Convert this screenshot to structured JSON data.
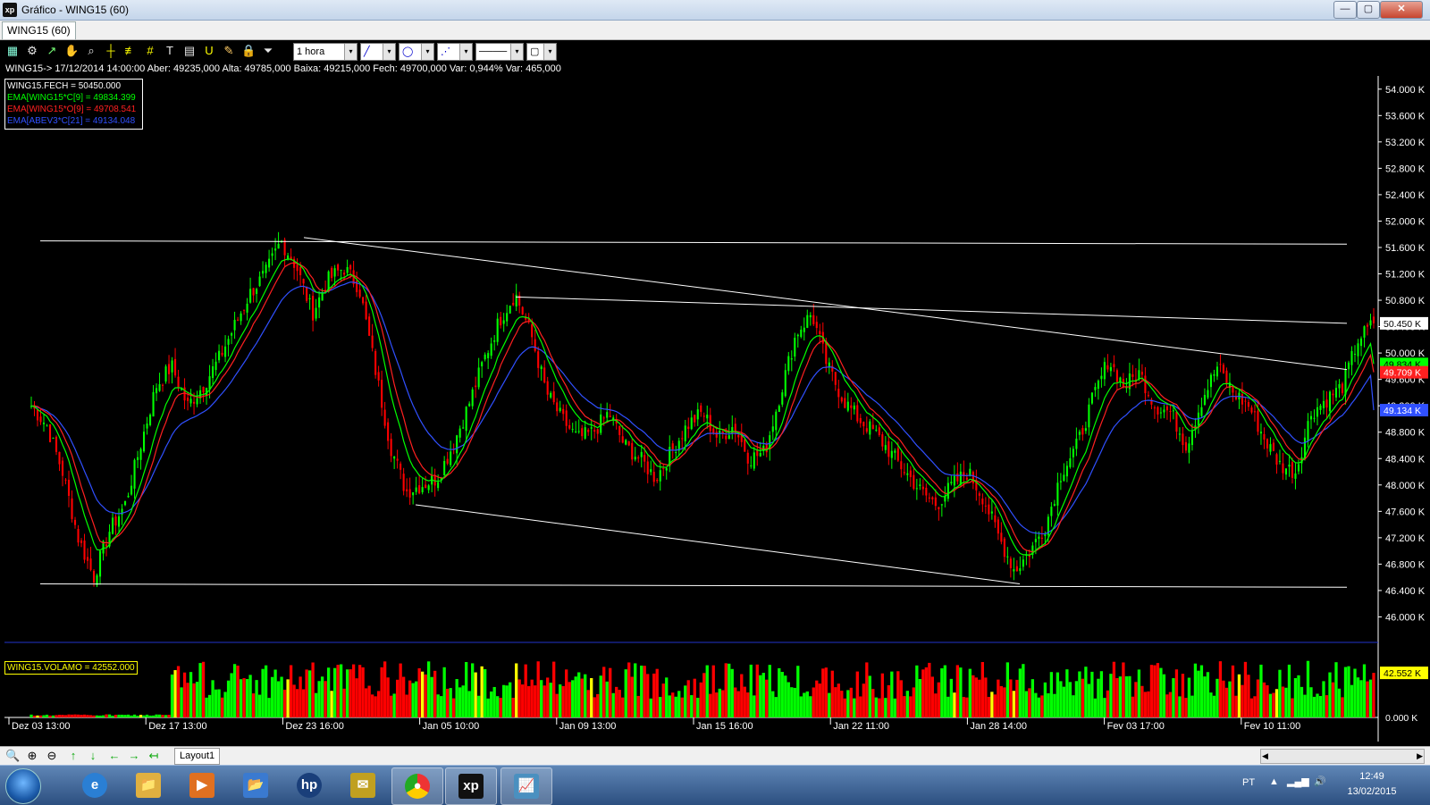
{
  "window": {
    "title": "Gráfico - WING15 (60)",
    "logo_text": "xp",
    "min": "—",
    "max": "▢",
    "close": "✕"
  },
  "doc_tab": "WING15 (60)",
  "toolbar": {
    "interval": "1 hora",
    "dropdown_glyph": "▾"
  },
  "info_line": "WING15-> 17/12/2014 14:00:00 Aber: 49235,000 Alta: 49785,000 Baixa: 49215,000 Fech: 49700,000 Var: 0,944% Var: 465,000",
  "legend": [
    {
      "text": "WING15.FECH = 50450.000",
      "color": "#ffffff"
    },
    {
      "text": "EMA[WING15*C[9] = 49834.399",
      "color": "#00ff00"
    },
    {
      "text": "EMA[WING15*O[9] = 49708.541",
      "color": "#ff2020"
    },
    {
      "text": "EMA[ABEV3*C[21] = 49134.048",
      "color": "#3050ff"
    }
  ],
  "vol_legend": "WING15.VOLAMO = 42552.000",
  "markers": {
    "last": "50.450 K",
    "ema_fast": "49.834 K",
    "ema_slow": "49.709 K",
    "ema_long": "49.134 K",
    "volume": "42.552 K"
  },
  "layout_tab": "Layout1",
  "colors": {
    "up": "#00ff00",
    "down": "#ff0000",
    "ema_fast": "#00ff00",
    "ema_slow": "#ff2020",
    "ema_long": "#3050ff",
    "trend": "#ffffff",
    "volume_alt": "#ffff00"
  },
  "chart_data": {
    "type": "candlestick",
    "instrument": "WING15",
    "interval": "1 hora",
    "y_ticks": [
      "54.000 K",
      "53.600 K",
      "53.200 K",
      "52.800 K",
      "52.400 K",
      "52.000 K",
      "51.600 K",
      "51.200 K",
      "50.800 K",
      "50.400 K",
      "50.000 K",
      "49.600 K",
      "49.200 K",
      "48.800 K",
      "48.400 K",
      "48.000 K",
      "47.600 K",
      "47.200 K",
      "46.800 K",
      "46.400 K",
      "46.000 K"
    ],
    "ylim": [
      45600,
      54200
    ],
    "x_ticks": [
      "Dez 03 13:00",
      "Dez 17 13:00",
      "Dez 23 16:00",
      "Jan 05 10:00",
      "Jan 09 13:00",
      "Jan 15 16:00",
      "Jan 22 11:00",
      "Jan 28 14:00",
      "Fev 03 17:00",
      "Fev 10 11:00"
    ],
    "close_path": [
      49200,
      48900,
      48200,
      47200,
      46600,
      47300,
      47700,
      48600,
      49500,
      49800,
      49200,
      49500,
      49900,
      50400,
      50900,
      51200,
      51700,
      51300,
      50600,
      51100,
      51300,
      51000,
      49800,
      48600,
      47900,
      48000,
      48100,
      48600,
      49200,
      49900,
      50500,
      50900,
      50300,
      49400,
      49000,
      48700,
      48800,
      49100,
      48600,
      48400,
      48100,
      48500,
      48900,
      49100,
      48700,
      48900,
      48400,
      48500,
      49400,
      50300,
      50600,
      49800,
      49300,
      49000,
      48800,
      48500,
      48200,
      47900,
      47700,
      48000,
      48200,
      47800,
      47200,
      46700,
      47000,
      47400,
      48200,
      48600,
      49300,
      49900,
      49500,
      49700,
      49200,
      49100,
      48600,
      49300,
      49800,
      49400,
      49200,
      48700,
      48300,
      48200,
      49100,
      49300,
      49500,
      50200,
      50450
    ],
    "ema_fast": 49834.399,
    "ema_slow": 49708.541,
    "ema_long": 49134.048,
    "last_close": 50450,
    "volume_ylim": [
      0,
      58000
    ],
    "volume_ticks": [
      "42.552 K",
      "0.000 K"
    ],
    "last_volume": 42552,
    "trendlines": [
      {
        "from": [
          "Dez 03 13:00",
          51700
        ],
        "to": [
          "Fev 10 11:00",
          51650
        ]
      },
      {
        "from": [
          "Dez 03 13:00",
          46500
        ],
        "to": [
          "Fev 10 11:00",
          46450
        ]
      },
      {
        "from": [
          "Dez 23 16:00",
          51750
        ],
        "to": [
          "Fev 10 11:00",
          49750
        ]
      },
      {
        "from": [
          "Jan 05 10:00",
          50850
        ],
        "to": [
          "Fev 10 11:00",
          50450
        ]
      },
      {
        "from": [
          "Jan 05 10:00",
          47700
        ],
        "to": [
          "Jan 28 14:00",
          46500
        ]
      }
    ]
  },
  "statusbar": {
    "tools": [
      "🔍",
      "⊕",
      "⊖",
      "↑",
      "↓",
      "←",
      "→",
      "↤"
    ]
  },
  "taskbar": {
    "lang": "PT",
    "time": "12:49",
    "date": "13/02/2015",
    "apps": [
      "e",
      "📁",
      "▶",
      "📂",
      "hp",
      "✉",
      "●",
      "xp",
      "📈"
    ]
  }
}
